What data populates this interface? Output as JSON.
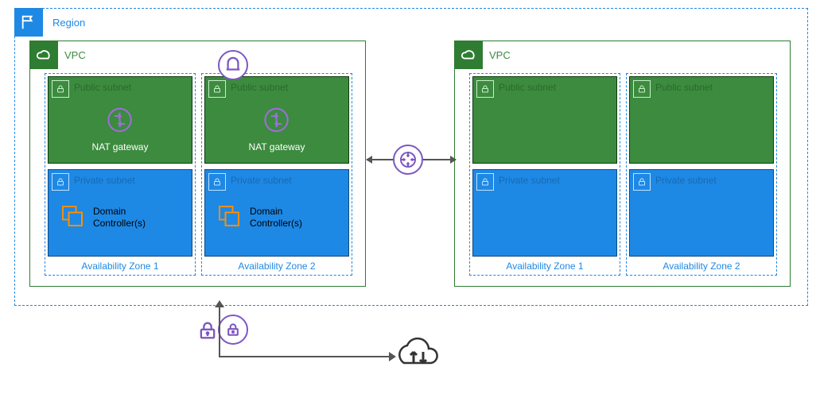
{
  "region": {
    "label": "Region"
  },
  "vpc": {
    "label": "VPC"
  },
  "left_vpc": {
    "az1": {
      "label": "Availability Zone 1",
      "public": {
        "title": "Public subnet",
        "nat": "NAT gateway"
      },
      "private": {
        "title": "Private subnet",
        "dc": "Domain\nController(s)"
      }
    },
    "az2": {
      "label": "Availability Zone 2",
      "public": {
        "title": "Public subnet",
        "nat": "NAT gateway"
      },
      "private": {
        "title": "Private subnet",
        "dc": "Domain\nController(s)"
      }
    }
  },
  "right_vpc": {
    "az1": {
      "label": "Availability Zone 1",
      "public": {
        "title": "Public subnet"
      },
      "private": {
        "title": "Private subnet"
      }
    },
    "az2": {
      "label": "Availability Zone 2",
      "public": {
        "title": "Public subnet"
      },
      "private": {
        "title": "Private subnet"
      }
    }
  },
  "icons": {
    "nat": "nat-gateway-icon",
    "ec2": "ec2-instances-icon",
    "igw": "internet-gateway-icon",
    "vpg": "vpn-gateway-icon",
    "cgw": "customer-gateway-icon",
    "tgw": "transit-gateway-icon",
    "datacenter": "data-center-icon"
  },
  "colors": {
    "region_border": "#1E88E5",
    "vpc_border": "#2E7D32",
    "public_fill": "#3C8B3F",
    "private_fill": "#1E88E5",
    "accent_purple": "#7E57C2",
    "accent_orange": "#FF8F00"
  }
}
